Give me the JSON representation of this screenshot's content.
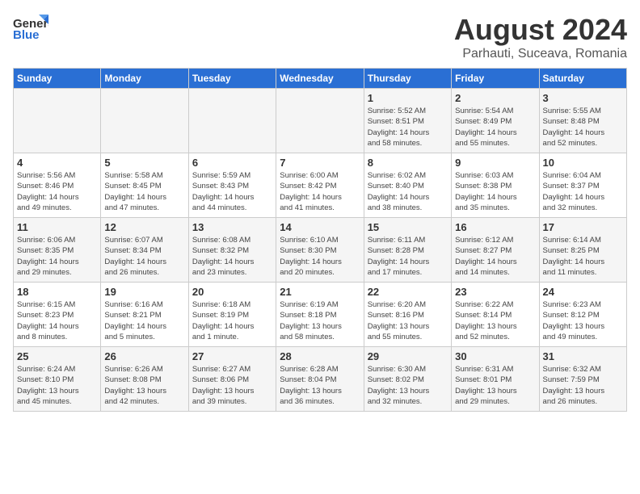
{
  "header": {
    "logo_general": "General",
    "logo_blue": "Blue",
    "month_year": "August 2024",
    "location": "Parhauti, Suceava, Romania"
  },
  "days_of_week": [
    "Sunday",
    "Monday",
    "Tuesday",
    "Wednesday",
    "Thursday",
    "Friday",
    "Saturday"
  ],
  "weeks": [
    [
      {
        "day": "",
        "info": "",
        "empty": true
      },
      {
        "day": "",
        "info": "",
        "empty": true
      },
      {
        "day": "",
        "info": "",
        "empty": true
      },
      {
        "day": "",
        "info": "",
        "empty": true
      },
      {
        "day": "1",
        "info": "Sunrise: 5:52 AM\nSunset: 8:51 PM\nDaylight: 14 hours\nand 58 minutes."
      },
      {
        "day": "2",
        "info": "Sunrise: 5:54 AM\nSunset: 8:49 PM\nDaylight: 14 hours\nand 55 minutes."
      },
      {
        "day": "3",
        "info": "Sunrise: 5:55 AM\nSunset: 8:48 PM\nDaylight: 14 hours\nand 52 minutes."
      }
    ],
    [
      {
        "day": "4",
        "info": "Sunrise: 5:56 AM\nSunset: 8:46 PM\nDaylight: 14 hours\nand 49 minutes."
      },
      {
        "day": "5",
        "info": "Sunrise: 5:58 AM\nSunset: 8:45 PM\nDaylight: 14 hours\nand 47 minutes."
      },
      {
        "day": "6",
        "info": "Sunrise: 5:59 AM\nSunset: 8:43 PM\nDaylight: 14 hours\nand 44 minutes."
      },
      {
        "day": "7",
        "info": "Sunrise: 6:00 AM\nSunset: 8:42 PM\nDaylight: 14 hours\nand 41 minutes."
      },
      {
        "day": "8",
        "info": "Sunrise: 6:02 AM\nSunset: 8:40 PM\nDaylight: 14 hours\nand 38 minutes."
      },
      {
        "day": "9",
        "info": "Sunrise: 6:03 AM\nSunset: 8:38 PM\nDaylight: 14 hours\nand 35 minutes."
      },
      {
        "day": "10",
        "info": "Sunrise: 6:04 AM\nSunset: 8:37 PM\nDaylight: 14 hours\nand 32 minutes."
      }
    ],
    [
      {
        "day": "11",
        "info": "Sunrise: 6:06 AM\nSunset: 8:35 PM\nDaylight: 14 hours\nand 29 minutes."
      },
      {
        "day": "12",
        "info": "Sunrise: 6:07 AM\nSunset: 8:34 PM\nDaylight: 14 hours\nand 26 minutes."
      },
      {
        "day": "13",
        "info": "Sunrise: 6:08 AM\nSunset: 8:32 PM\nDaylight: 14 hours\nand 23 minutes."
      },
      {
        "day": "14",
        "info": "Sunrise: 6:10 AM\nSunset: 8:30 PM\nDaylight: 14 hours\nand 20 minutes."
      },
      {
        "day": "15",
        "info": "Sunrise: 6:11 AM\nSunset: 8:28 PM\nDaylight: 14 hours\nand 17 minutes."
      },
      {
        "day": "16",
        "info": "Sunrise: 6:12 AM\nSunset: 8:27 PM\nDaylight: 14 hours\nand 14 minutes."
      },
      {
        "day": "17",
        "info": "Sunrise: 6:14 AM\nSunset: 8:25 PM\nDaylight: 14 hours\nand 11 minutes."
      }
    ],
    [
      {
        "day": "18",
        "info": "Sunrise: 6:15 AM\nSunset: 8:23 PM\nDaylight: 14 hours\nand 8 minutes."
      },
      {
        "day": "19",
        "info": "Sunrise: 6:16 AM\nSunset: 8:21 PM\nDaylight: 14 hours\nand 5 minutes."
      },
      {
        "day": "20",
        "info": "Sunrise: 6:18 AM\nSunset: 8:19 PM\nDaylight: 14 hours\nand 1 minute."
      },
      {
        "day": "21",
        "info": "Sunrise: 6:19 AM\nSunset: 8:18 PM\nDaylight: 13 hours\nand 58 minutes."
      },
      {
        "day": "22",
        "info": "Sunrise: 6:20 AM\nSunset: 8:16 PM\nDaylight: 13 hours\nand 55 minutes."
      },
      {
        "day": "23",
        "info": "Sunrise: 6:22 AM\nSunset: 8:14 PM\nDaylight: 13 hours\nand 52 minutes."
      },
      {
        "day": "24",
        "info": "Sunrise: 6:23 AM\nSunset: 8:12 PM\nDaylight: 13 hours\nand 49 minutes."
      }
    ],
    [
      {
        "day": "25",
        "info": "Sunrise: 6:24 AM\nSunset: 8:10 PM\nDaylight: 13 hours\nand 45 minutes."
      },
      {
        "day": "26",
        "info": "Sunrise: 6:26 AM\nSunset: 8:08 PM\nDaylight: 13 hours\nand 42 minutes."
      },
      {
        "day": "27",
        "info": "Sunrise: 6:27 AM\nSunset: 8:06 PM\nDaylight: 13 hours\nand 39 minutes."
      },
      {
        "day": "28",
        "info": "Sunrise: 6:28 AM\nSunset: 8:04 PM\nDaylight: 13 hours\nand 36 minutes."
      },
      {
        "day": "29",
        "info": "Sunrise: 6:30 AM\nSunset: 8:02 PM\nDaylight: 13 hours\nand 32 minutes."
      },
      {
        "day": "30",
        "info": "Sunrise: 6:31 AM\nSunset: 8:01 PM\nDaylight: 13 hours\nand 29 minutes."
      },
      {
        "day": "31",
        "info": "Sunrise: 6:32 AM\nSunset: 7:59 PM\nDaylight: 13 hours\nand 26 minutes."
      }
    ]
  ]
}
